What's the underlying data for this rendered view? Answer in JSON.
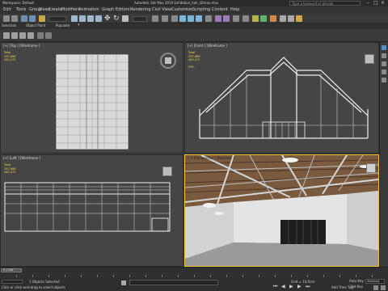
{
  "window": {
    "workspace": "Workspace: Default",
    "title": "Autodesk 3ds Max 2016   Exhibition_hall_42max.max",
    "search_placeholder": "Type a keyword or phrase"
  },
  "menu": [
    "Edit",
    "Tools",
    "Group",
    "Views",
    "Create",
    "Modifiers",
    "Animation",
    "Graph Editors",
    "Rendering",
    "Civil View",
    "Customize",
    "Scripting",
    "Content",
    "Help"
  ],
  "ribbon": [
    "Selection",
    "Object Paint",
    "Populate"
  ],
  "viewports": {
    "top": {
      "label": "[+] [Top ] [Wireframe ]"
    },
    "front": {
      "label": "[+] [Front ] [Wireframe ]"
    },
    "left": {
      "label": "[+] [Left ] [Wireframe ]"
    },
    "persp": {
      "label": "[+] [Perspective ] [Realistic ]"
    }
  },
  "stats": {
    "total_label": "Total",
    "polys": "397,888",
    "verts": "462,472",
    "fps_label": "FPS:"
  },
  "timeline": {
    "frame": "0 / 100"
  },
  "status": {
    "selection": "1 Objects Selected",
    "prompt": "Click or click-and-drag to select objects",
    "grid": "Grid = 10,0cm",
    "auto_key": "Auto Key",
    "set_key": "Set Key",
    "selected": "Selected",
    "add_time_tag": "Add Time Tag"
  },
  "colors": {
    "active_border": "#f1c232",
    "stats_text": "#f2d43c",
    "viewport_bg": "#454545"
  }
}
